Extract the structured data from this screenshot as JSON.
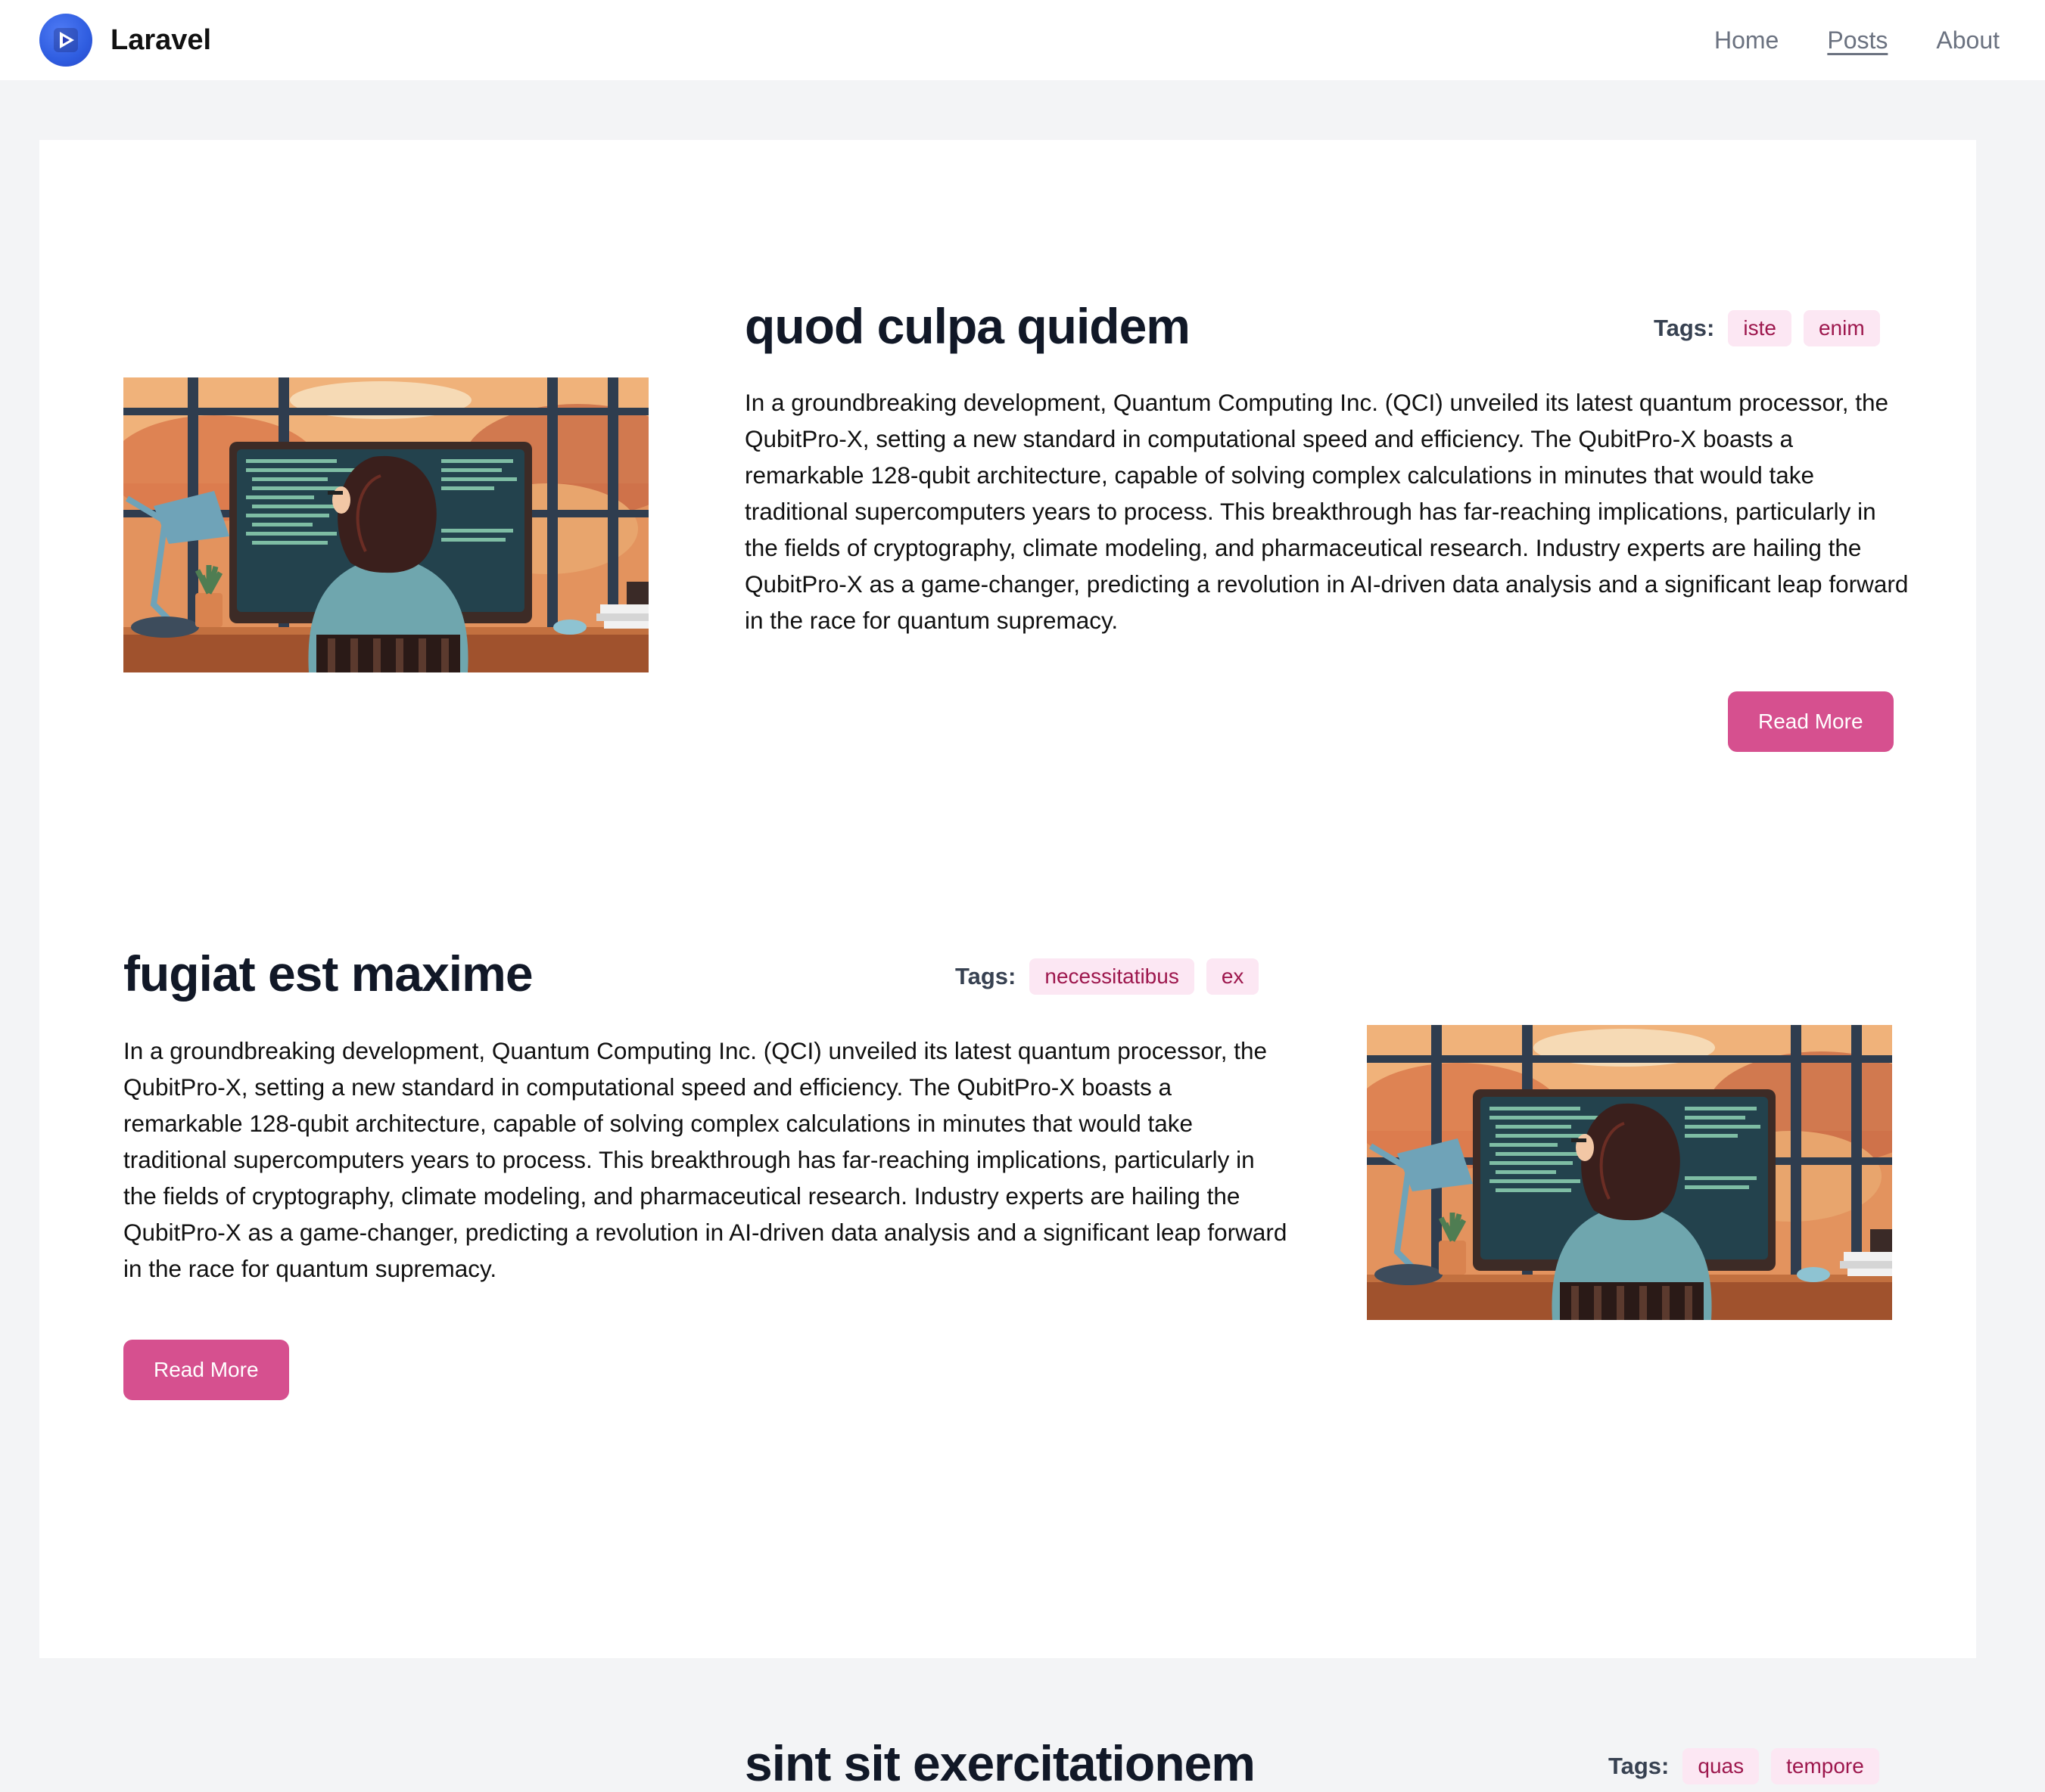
{
  "header": {
    "brand": "Laravel",
    "logo_icon": "play-icon",
    "nav": [
      {
        "label": "Home",
        "active": false
      },
      {
        "label": "Posts",
        "active": true
      },
      {
        "label": "About",
        "active": false
      }
    ]
  },
  "posts": [
    {
      "title": "quod culpa quidem",
      "tags_label": "Tags:",
      "tags": [
        "iste",
        "enim"
      ],
      "body": "In a groundbreaking development, Quantum Computing Inc. (QCI) unveiled its latest quantum processor, the QubitPro-X, setting a new standard in computational speed and efficiency. The QubitPro-X boasts a remarkable 128-qubit architecture, capable of solving complex calculations in minutes that would take traditional supercomputers years to process. This breakthrough has far-reaching implications, particularly in the fields of cryptography, climate modeling, and pharmaceutical research. Industry experts are hailing the QubitPro-X as a game-changer, predicting a revolution in AI-driven data analysis and a significant leap forward in the race for quantum supremacy.",
      "read_more": "Read More",
      "image": "woman-coding-at-desk-illustration"
    },
    {
      "title": "fugiat est maxime",
      "tags_label": "Tags:",
      "tags": [
        "necessitatibus",
        "ex"
      ],
      "body": "In a groundbreaking development, Quantum Computing Inc. (QCI) unveiled its latest quantum processor, the QubitPro-X, setting a new standard in computational speed and efficiency. The QubitPro-X boasts a remarkable 128-qubit architecture, capable of solving complex calculations in minutes that would take traditional supercomputers years to process. This breakthrough has far-reaching implications, particularly in the fields of cryptography, climate modeling, and pharmaceutical research. Industry experts are hailing the QubitPro-X as a game-changer, predicting a revolution in AI-driven data analysis and a significant leap forward in the race for quantum supremacy.",
      "read_more": "Read More",
      "image": "woman-coding-at-desk-illustration"
    },
    {
      "title": "sint sit exercitationem",
      "tags_label": "Tags:",
      "tags": [
        "quas",
        "tempore"
      ]
    }
  ],
  "colors": {
    "accent": "#d6508f",
    "tag_bg": "#fce7f3",
    "tag_text": "#9d174d",
    "page_bg": "#f3f4f6"
  }
}
